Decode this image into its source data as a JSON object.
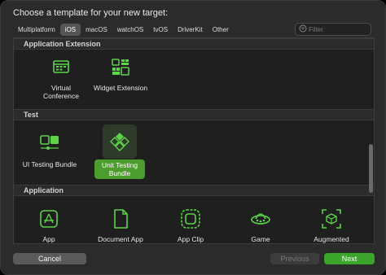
{
  "title": "Choose a template for your new target:",
  "tabs": [
    "Multiplatform",
    "iOS",
    "macOS",
    "watchOS",
    "tvOS",
    "DriverKit",
    "Other"
  ],
  "selected_tab": "iOS",
  "filter": {
    "placeholder": "Filter"
  },
  "sections": {
    "app_extension": {
      "label": "Application Extension",
      "items": [
        {
          "label": "Virtual\nConference",
          "icon": "virtual-conference-icon"
        },
        {
          "label": "Widget Extension",
          "icon": "widget-extension-icon"
        }
      ]
    },
    "test": {
      "label": "Test",
      "items": [
        {
          "label": "UI Testing Bundle",
          "icon": "ui-testing-bundle-icon"
        },
        {
          "label": "Unit Testing\nBundle",
          "icon": "unit-testing-bundle-icon",
          "selected": true
        }
      ]
    },
    "application": {
      "label": "Application",
      "items": [
        {
          "label": "App",
          "icon": "app-icon"
        },
        {
          "label": "Document App",
          "icon": "document-app-icon"
        },
        {
          "label": "App Clip",
          "icon": "app-clip-icon"
        },
        {
          "label": "Game",
          "icon": "game-icon"
        },
        {
          "label": "Augmented",
          "icon": "augmented-reality-icon"
        }
      ]
    }
  },
  "buttons": {
    "cancel": "Cancel",
    "previous": "Previous",
    "next": "Next"
  },
  "colors": {
    "accent": "#3aa52a",
    "icon": "#5dd447",
    "background": "#1f1f1f"
  }
}
